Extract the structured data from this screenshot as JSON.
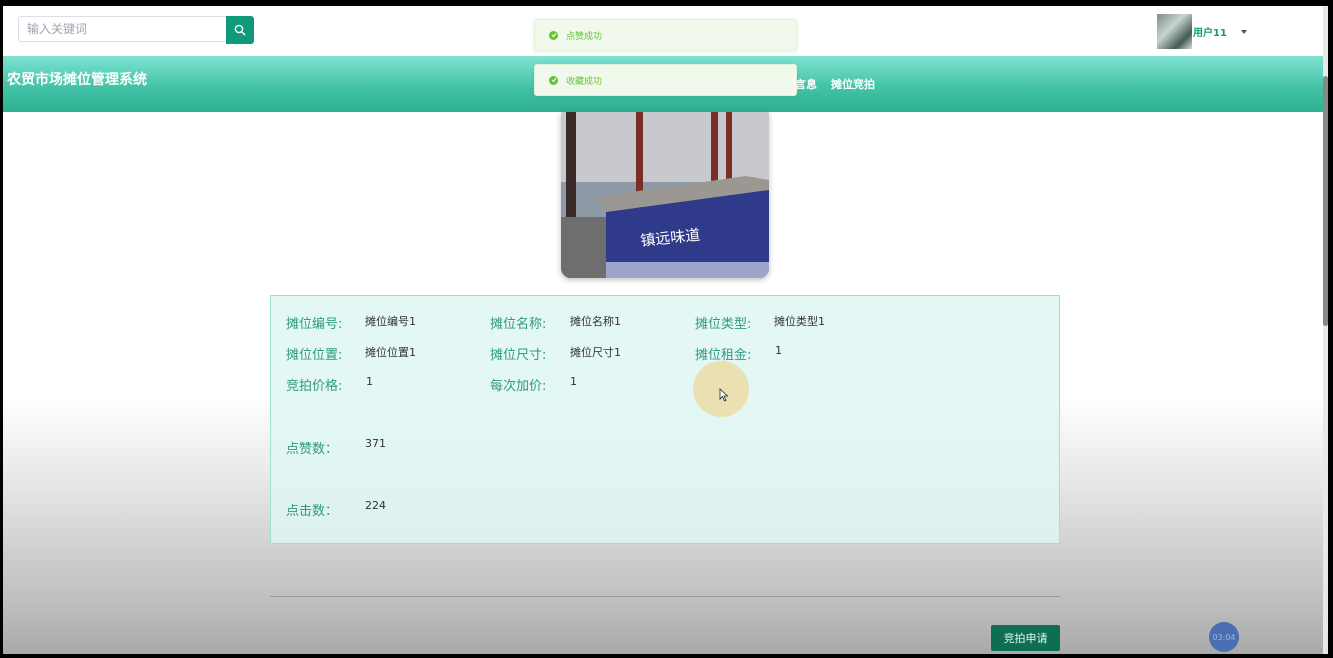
{
  "search": {
    "placeholder": "输入关键词"
  },
  "toasts": [
    "点赞成功",
    "收藏成功"
  ],
  "user": {
    "name": "用户11"
  },
  "navbar": {
    "brand": "农贸市场摊位管理系统",
    "partial_item": "言息",
    "item_auction": "摊位竞拍"
  },
  "details": {
    "stall_no_label": "摊位编号:",
    "stall_no": "摊位编号1",
    "stall_name_label": "摊位名称:",
    "stall_name": "摊位名称1",
    "stall_type_label": "摊位类型:",
    "stall_type": "摊位类型1",
    "stall_location_label": "摊位位置:",
    "stall_location": "摊位位置1",
    "stall_size_label": "摊位尺寸:",
    "stall_size": "摊位尺寸1",
    "stall_rent_label": "摊位租金:",
    "stall_rent": "1",
    "auction_price_label": "竞拍价格:",
    "auction_price": "1",
    "increment_label": "每次加价:",
    "increment": "1",
    "likes_label": "点赞数：",
    "likes": "371",
    "clicks_label": "点击数：",
    "clicks": "224"
  },
  "bid_button": "竞拍申请",
  "timer": "03:04",
  "photo": {
    "sign_text": "镇远味道"
  },
  "colors": {
    "primary": "#109a7a",
    "navbar": "#44c3a6",
    "success": "#67c23a",
    "bid_button": "#0e6e51"
  }
}
